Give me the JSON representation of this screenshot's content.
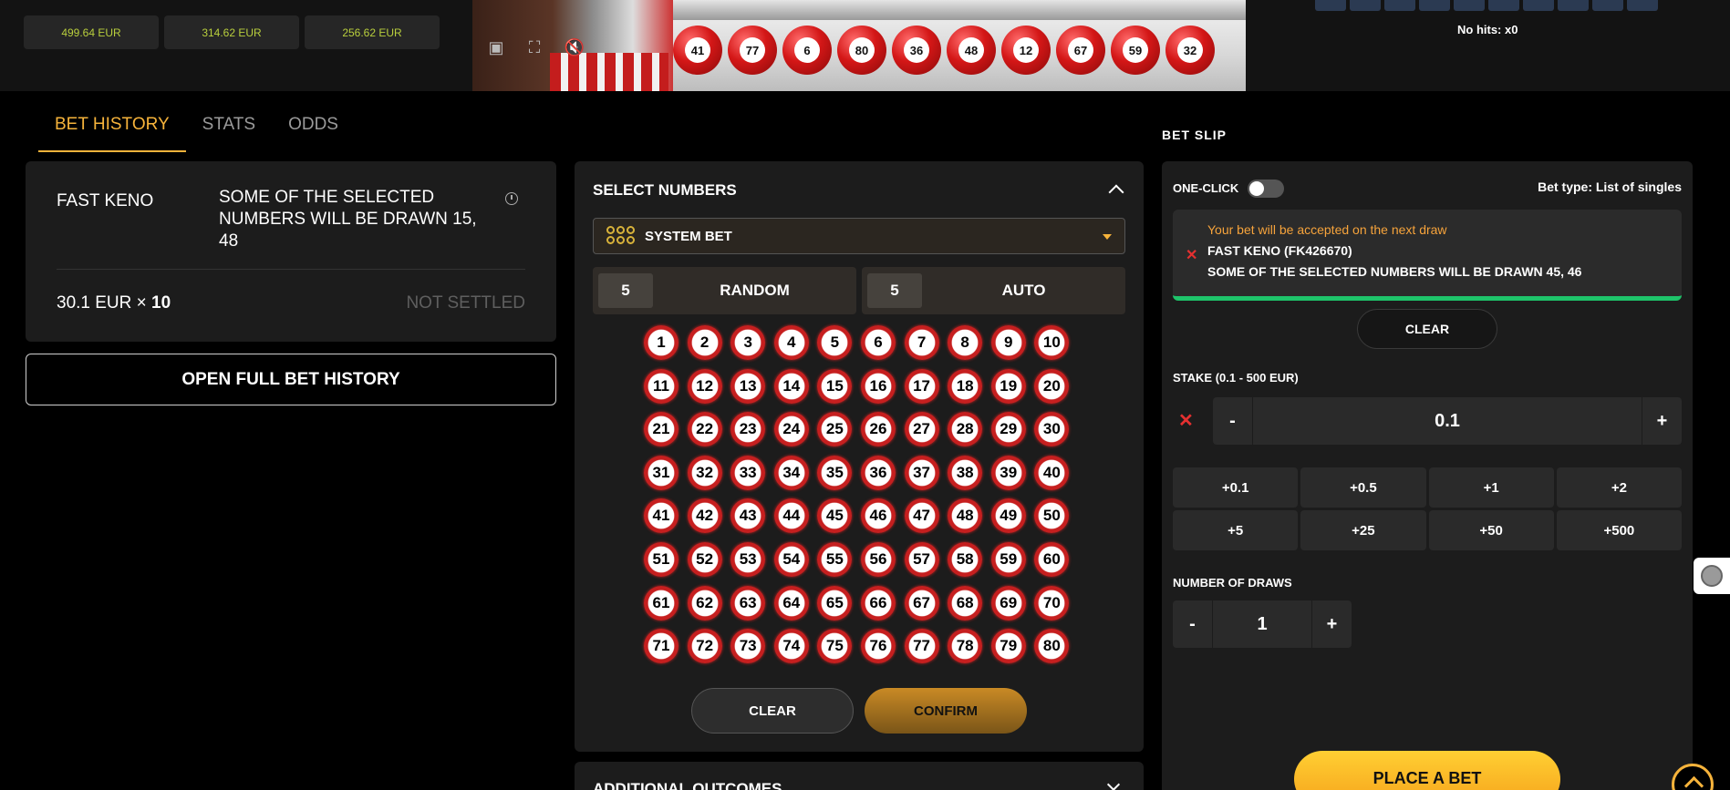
{
  "top": {
    "jackpots": [
      "499.64 EUR",
      "314.62 EUR",
      "256.62 EUR"
    ],
    "drawn_balls": [
      "41",
      "77",
      "6",
      "80",
      "36",
      "48",
      "12",
      "67",
      "59",
      "32"
    ],
    "no_hits": "No hits: x0"
  },
  "tabs": [
    {
      "label": "BET HISTORY",
      "active": true
    },
    {
      "label": "STATS",
      "active": false
    },
    {
      "label": "ODDS",
      "active": false
    }
  ],
  "history": {
    "game": "FAST KENO",
    "description": "SOME OF THE SELECTED NUMBERS WILL BE DRAWN 15, 48",
    "stake": "30.1 EUR",
    "multiplier_sign": "×",
    "multiplier": "10",
    "status": "NOT SETTLED",
    "open_full": "OPEN FULL BET HISTORY"
  },
  "select": {
    "title": "SELECT NUMBERS",
    "mode": "SYSTEM BET",
    "random_count": "5",
    "random_label": "RANDOM",
    "auto_count": "5",
    "auto_label": "AUTO",
    "numbers": [
      "1",
      "2",
      "3",
      "4",
      "5",
      "6",
      "7",
      "8",
      "9",
      "10",
      "11",
      "12",
      "13",
      "14",
      "15",
      "16",
      "17",
      "18",
      "19",
      "20",
      "21",
      "22",
      "23",
      "24",
      "25",
      "26",
      "27",
      "28",
      "29",
      "30",
      "31",
      "32",
      "33",
      "34",
      "35",
      "36",
      "37",
      "38",
      "39",
      "40",
      "41",
      "42",
      "43",
      "44",
      "45",
      "46",
      "47",
      "48",
      "49",
      "50",
      "51",
      "52",
      "53",
      "54",
      "55",
      "56",
      "57",
      "58",
      "59",
      "60",
      "61",
      "62",
      "63",
      "64",
      "65",
      "66",
      "67",
      "68",
      "69",
      "70",
      "71",
      "72",
      "73",
      "74",
      "75",
      "76",
      "77",
      "78",
      "79",
      "80"
    ],
    "clear": "CLEAR",
    "confirm": "CONFIRM",
    "additional": "ADDITIONAL OUTCOMES"
  },
  "slip": {
    "title": "BET SLIP",
    "one_click": "ONE-CLICK",
    "bet_type": "Bet type:  List of singles",
    "notice": "Your bet will be accepted on the next draw",
    "notice_game": "FAST KENO (FK426670)",
    "notice_selection": "SOME OF THE SELECTED NUMBERS WILL BE DRAWN 45, 46",
    "clear": "CLEAR",
    "stake_label": "STAKE (0.1 - 500  EUR)",
    "minus": "-",
    "stake_value": "0.1",
    "plus": "+",
    "quick": [
      "+0.1",
      "+0.5",
      "+1",
      "+2",
      "+5",
      "+25",
      "+50",
      "+500"
    ],
    "draws_label": "NUMBER OF DRAWS",
    "draws_value": "1",
    "place": "PLACE A BET"
  }
}
